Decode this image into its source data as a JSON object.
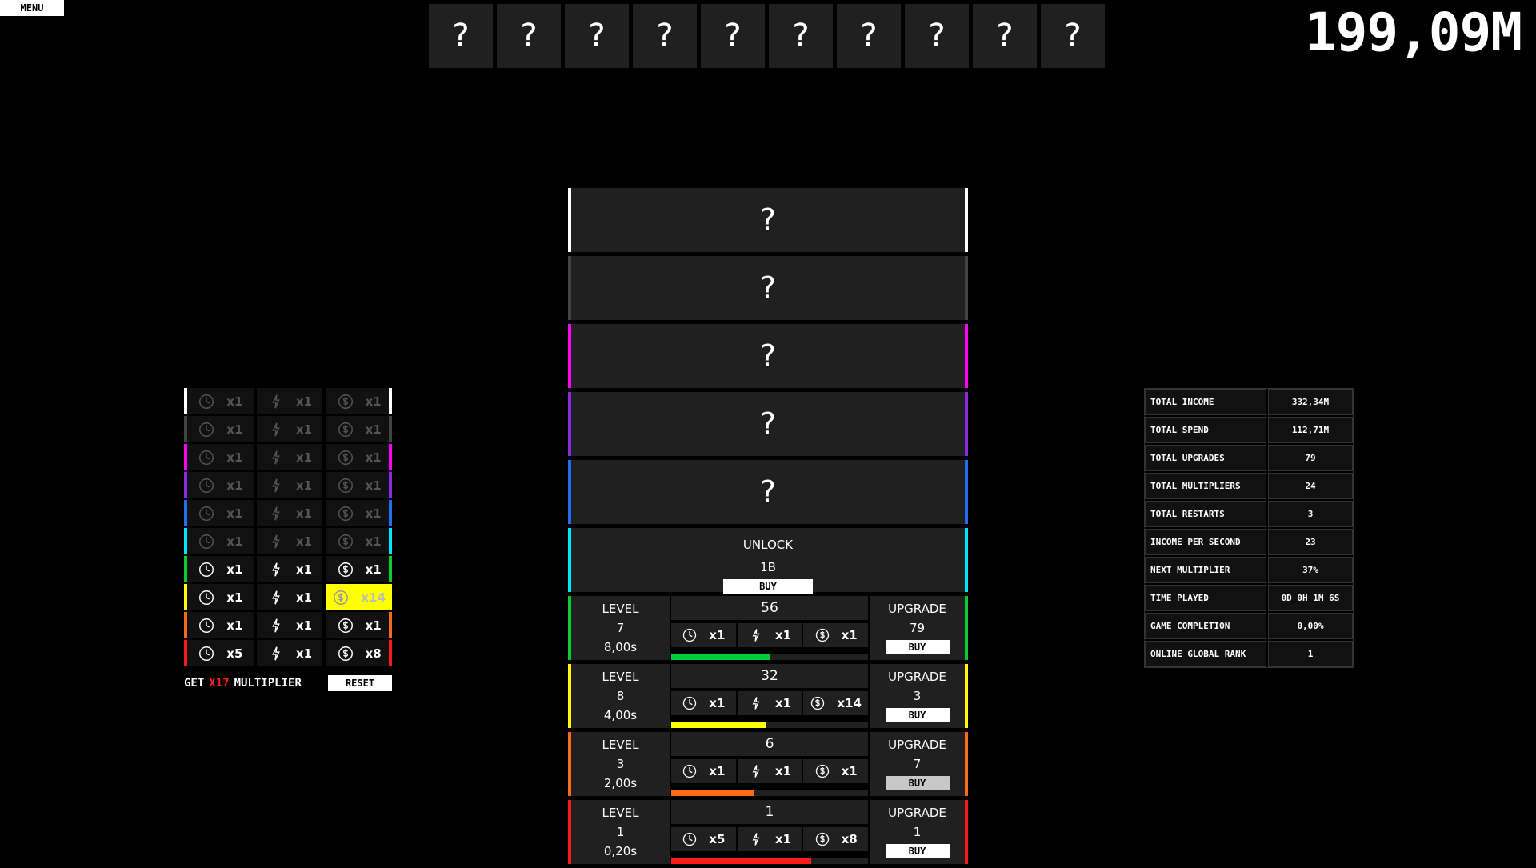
{
  "menu_label": "MENU",
  "money": "199,09M",
  "top_slots": [
    "?",
    "?",
    "?",
    "?",
    "?",
    "?",
    "?",
    "?",
    "?",
    "?"
  ],
  "colors": {
    "white": "#ffffff",
    "gray": "#444444",
    "magenta": "#ff00ff",
    "purple": "#8a2be2",
    "blue": "#1e6fff",
    "cyan": "#00e5ff",
    "green": "#00cc33",
    "yellow": "#ffff00",
    "orange": "#ff6a1a",
    "red": "#ff1a1a"
  },
  "multipliers": [
    {
      "color": "white",
      "time": "x1",
      "speed": "x1",
      "money": "x1",
      "dim": true
    },
    {
      "color": "gray",
      "time": "x1",
      "speed": "x1",
      "money": "x1",
      "dim": true
    },
    {
      "color": "magenta",
      "time": "x1",
      "speed": "x1",
      "money": "x1",
      "dim": true
    },
    {
      "color": "purple",
      "time": "x1",
      "speed": "x1",
      "money": "x1",
      "dim": true
    },
    {
      "color": "blue",
      "time": "x1",
      "speed": "x1",
      "money": "x1",
      "dim": true
    },
    {
      "color": "cyan",
      "time": "x1",
      "speed": "x1",
      "money": "x1",
      "dim": true
    },
    {
      "color": "green",
      "time": "x1",
      "speed": "x1",
      "money": "x1",
      "dim": false
    },
    {
      "color": "yellow",
      "time": "x1",
      "speed": "x1",
      "money": "x14",
      "dim": false,
      "highlight": true
    },
    {
      "color": "orange",
      "time": "x1",
      "speed": "x1",
      "money": "x1",
      "dim": false
    },
    {
      "color": "red",
      "time": "x5",
      "speed": "x1",
      "money": "x8",
      "dim": false
    }
  ],
  "mult_footer": {
    "get": "GET",
    "value": "X17",
    "suffix": "MULTIPLIER",
    "reset": "RESET"
  },
  "locked_rows": [
    {
      "color": "white",
      "label": "?"
    },
    {
      "color": "gray",
      "label": "?"
    },
    {
      "color": "magenta",
      "label": "?"
    },
    {
      "color": "purple",
      "label": "?"
    },
    {
      "color": "blue",
      "label": "?"
    }
  ],
  "unlock_row": {
    "color": "cyan",
    "title": "UNLOCK",
    "cost": "1B",
    "buy": "BUY"
  },
  "producers": [
    {
      "color": "green",
      "level_label": "LEVEL",
      "level": "7",
      "time": "8,00s",
      "count": "56",
      "time_mult": "x1",
      "speed_mult": "x1",
      "money_mult": "x1",
      "progress": 0.5,
      "upgrade_label": "UPGRADE",
      "upgrade_cost": "79",
      "buy": "BUY"
    },
    {
      "color": "yellow",
      "level_label": "LEVEL",
      "level": "8",
      "time": "4,00s",
      "count": "32",
      "time_mult": "x1",
      "speed_mult": "x1",
      "money_mult": "x14",
      "progress": 0.48,
      "upgrade_label": "UPGRADE",
      "upgrade_cost": "3",
      "buy": "BUY"
    },
    {
      "color": "orange",
      "level_label": "LEVEL",
      "level": "3",
      "time": "2,00s",
      "count": "6",
      "time_mult": "x1",
      "speed_mult": "x1",
      "money_mult": "x1",
      "progress": 0.42,
      "upgrade_label": "UPGRADE",
      "upgrade_cost": "7",
      "buy": "BUY",
      "hover": true
    },
    {
      "color": "red",
      "level_label": "LEVEL",
      "level": "1",
      "time": "0,20s",
      "count": "1",
      "time_mult": "x5",
      "speed_mult": "x1",
      "money_mult": "x8",
      "progress": 0.71,
      "upgrade_label": "UPGRADE",
      "upgrade_cost": "1",
      "buy": "BUY"
    }
  ],
  "stats": [
    {
      "key": "TOTAL INCOME",
      "value": "332,34M"
    },
    {
      "key": "TOTAL SPEND",
      "value": "112,71M"
    },
    {
      "key": "TOTAL UPGRADES",
      "value": "79"
    },
    {
      "key": "TOTAL MULTIPLIERS",
      "value": "24"
    },
    {
      "key": "TOTAL RESTARTS",
      "value": "3"
    },
    {
      "key": "INCOME PER SECOND",
      "value": "23"
    },
    {
      "key": "NEXT MULTIPLIER",
      "value": "37%"
    },
    {
      "key": "TIME PLAYED",
      "value": "0D 0H 1M 6S"
    },
    {
      "key": "GAME COMPLETION",
      "value": "0,00%"
    },
    {
      "key": "ONLINE GLOBAL RANK",
      "value": "1"
    }
  ]
}
